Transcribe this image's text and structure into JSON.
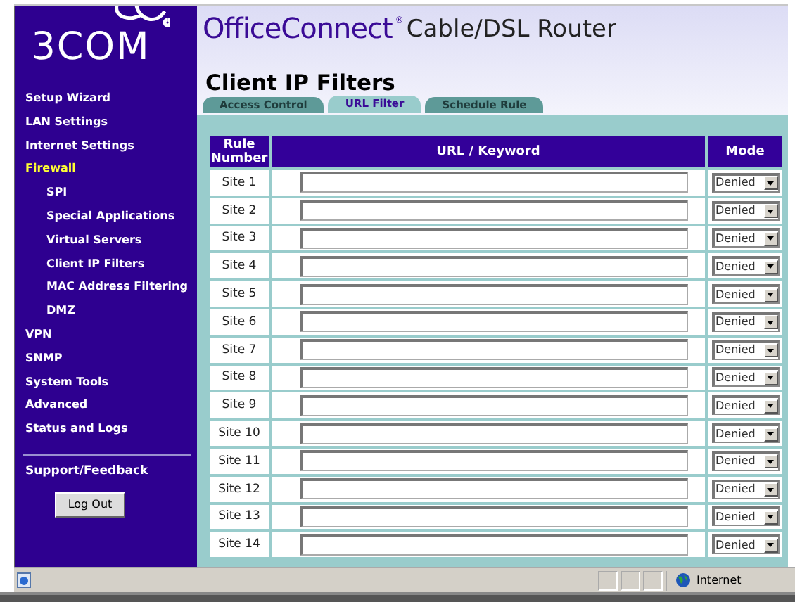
{
  "logo": {
    "text": "3COM"
  },
  "header": {
    "brand": "OfficeConnect",
    "mark": "®",
    "product": "Cable/DSL Router"
  },
  "sidebar": {
    "items": [
      {
        "label": "Setup Wizard",
        "selected": false
      },
      {
        "label": "LAN Settings",
        "selected": false
      },
      {
        "label": "Internet Settings",
        "selected": false
      },
      {
        "label": "Firewall",
        "selected": true,
        "children": [
          {
            "label": "SPI",
            "selected": false
          },
          {
            "label": "Special Applications",
            "selected": false
          },
          {
            "label": "Virtual Servers",
            "selected": false
          },
          {
            "label": "Client IP Filters",
            "selected": false
          },
          {
            "label": "MAC Address Filtering",
            "selected": false
          },
          {
            "label": "DMZ",
            "selected": false
          }
        ]
      },
      {
        "label": "VPN",
        "selected": false
      },
      {
        "label": "SNMP",
        "selected": false
      },
      {
        "label": "System Tools",
        "selected": false
      },
      {
        "label": "Advanced",
        "selected": false
      },
      {
        "label": "Status and Logs",
        "selected": false
      }
    ],
    "support_link": "Support/Feedback",
    "logout_button": "Log Out"
  },
  "page_title": "Client IP Filters",
  "tabs": [
    {
      "label": "Access Control",
      "selected": false
    },
    {
      "label": "URL Filter",
      "selected": true
    },
    {
      "label": "Schedule Rule",
      "selected": false
    }
  ],
  "table": {
    "columns": [
      "Rule Number",
      "URL / Keyword",
      "Mode"
    ],
    "rows": [
      {
        "rule": "Site 1",
        "mode": "Denied"
      },
      {
        "rule": "Site 2",
        "mode": "Denied"
      },
      {
        "rule": "Site 3",
        "mode": "Denied"
      },
      {
        "rule": "Site 4",
        "mode": "Denied"
      },
      {
        "rule": "Site 5",
        "mode": "Denied"
      },
      {
        "rule": "Site 6",
        "mode": "Denied"
      },
      {
        "rule": "Site 7",
        "mode": "Denied"
      },
      {
        "rule": "Site 8",
        "mode": "Denied"
      },
      {
        "rule": "Site 9",
        "mode": "Denied"
      },
      {
        "rule": "Site 10",
        "mode": "Denied"
      },
      {
        "rule": "Site 11",
        "mode": "Denied"
      },
      {
        "rule": "Site 12",
        "mode": "Denied"
      },
      {
        "rule": "Site 13",
        "mode": "Denied"
      },
      {
        "rule": "Site 14",
        "mode": "Denied"
      }
    ]
  },
  "status_bar": {
    "zone": "Internet"
  }
}
